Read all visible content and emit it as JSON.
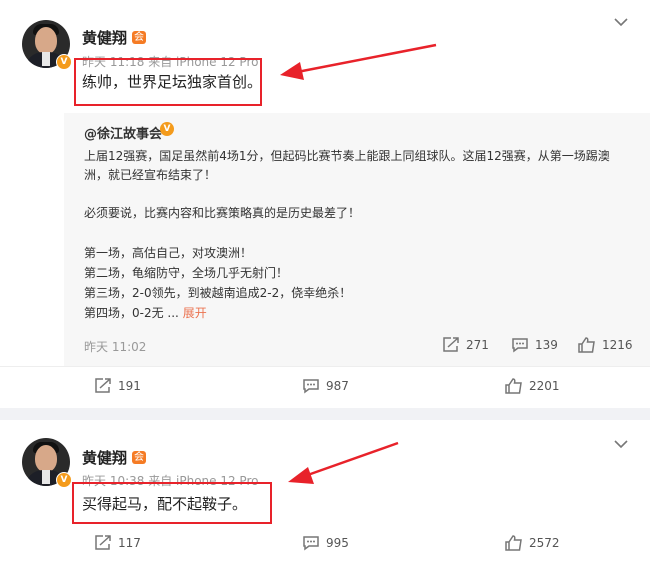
{
  "posts": [
    {
      "author": "黄健翔",
      "vip_badge": "会",
      "meta": "昨天 11:18 来自 iPhone 12 Pro",
      "text": "练帅，世界足坛独家首创。",
      "repost": {
        "author": "@徐江故事会",
        "lines": [
          "上届12强赛，国足虽然前4场1分，但起码比赛节奏上能跟上同组球队。这届12强赛，从第一场踢澳",
          "洲，就已经宣布结束了！",
          "必须要说，比赛内容和比赛策略真的是历史最差了！",
          "第一场，高估自己，对攻澳洲！",
          "第二场，龟缩防守，全场几乎无射门！",
          "第三场，2-0领先，到被越南追成2-2，侥幸绝杀！",
          "第四场，0-2无 ..."
        ],
        "more_label": "展开",
        "time": "昨天 11:02",
        "reposts": "271",
        "comments": "139",
        "likes": "1216"
      },
      "reposts": "191",
      "comments": "987",
      "likes": "2201"
    },
    {
      "author": "黄健翔",
      "vip_badge": "会",
      "meta": "昨天 10:38 来自 iPhone 12 Pro",
      "text": "买得起马，配不起鞍子。",
      "reposts": "117",
      "comments": "995",
      "likes": "2572"
    }
  ],
  "colors": {
    "highlight": "#e8222a",
    "vip": "#f57b24",
    "more_link": "#eb7350"
  },
  "icons": {
    "repost": "repost-icon",
    "comment": "comment-icon",
    "like": "like-icon",
    "menu": "chevron-down-icon",
    "verified": "verified-v-icon"
  }
}
